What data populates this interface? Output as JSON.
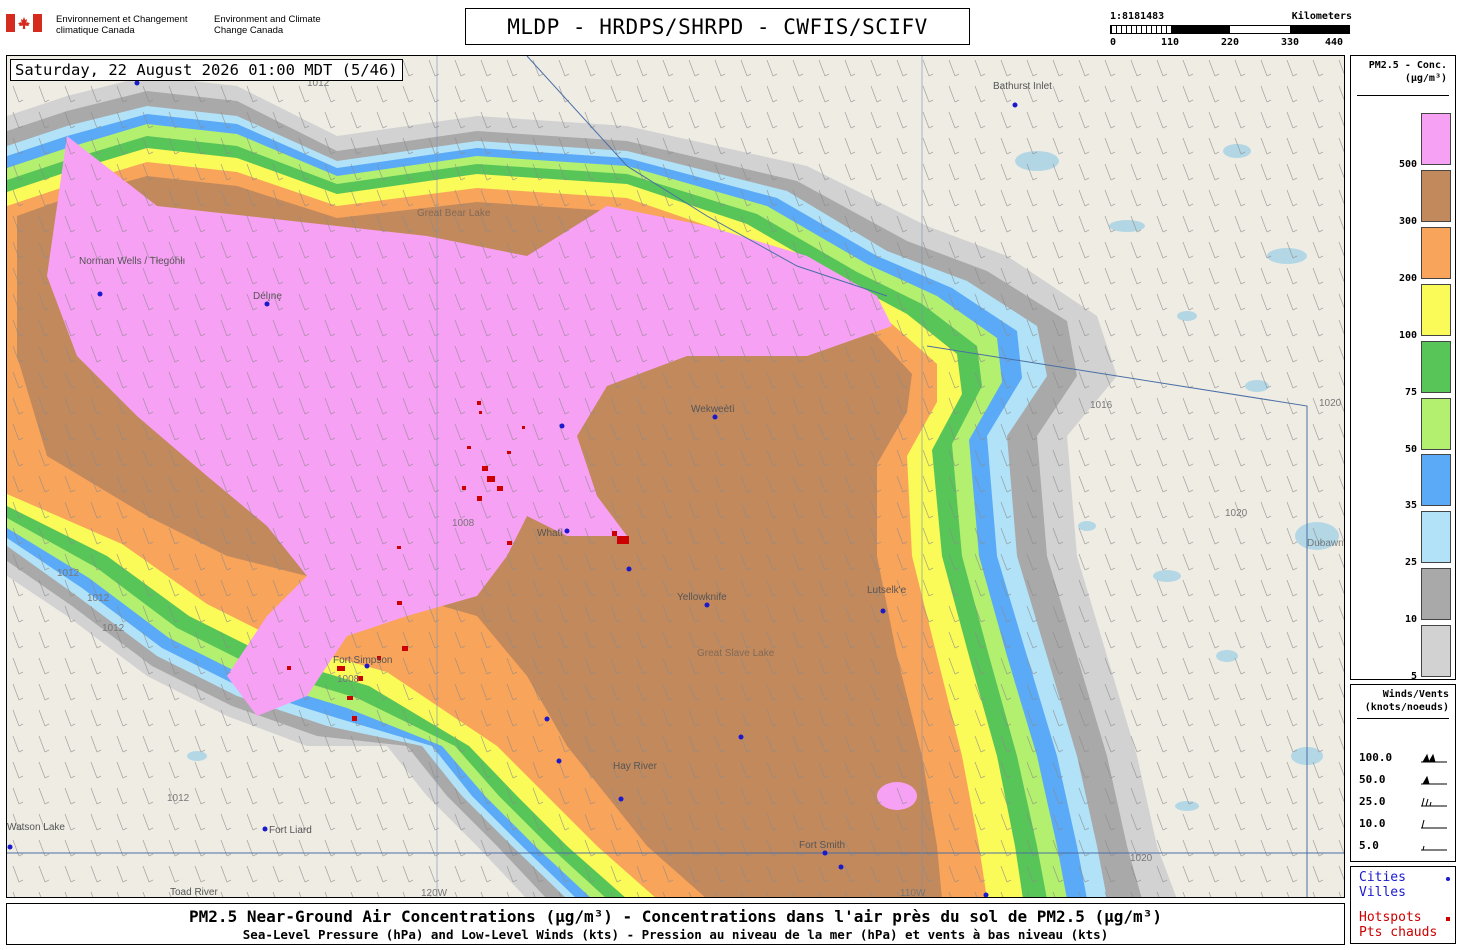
{
  "header": {
    "agency_fr": "Environnement et Changement climatique Canada",
    "agency_en": "Environment and Climate Change Canada",
    "title": "MLDP - HRDPS/SHRPD - CWFIS/SCIFV"
  },
  "scale": {
    "ratio": "1:8181483",
    "unit": "Kilometers",
    "ticks": [
      "0",
      "110",
      "220",
      "330",
      "440"
    ]
  },
  "map": {
    "timestamp": "Saturday, 22 August 2026 01:00 MDT (5/46)",
    "places": [
      {
        "name": "Bathurst Inlet"
      },
      {
        "name": "Norman Wells / Tłegóhłı"
      },
      {
        "name": "Délı̨nę"
      },
      {
        "name": "Great Bear Lake"
      },
      {
        "name": "Wekweètì"
      },
      {
        "name": "Whatì"
      },
      {
        "name": "Yellowknife"
      },
      {
        "name": "Fort Simpson"
      },
      {
        "name": "Lutselk'e"
      },
      {
        "name": "Hay River"
      },
      {
        "name": "Fort Liard"
      },
      {
        "name": "Fort Smith"
      },
      {
        "name": "Toad River"
      },
      {
        "name": "Dubawnt Lake"
      },
      {
        "name": "Watson Lake"
      },
      {
        "name": "Great Slave Lake"
      }
    ],
    "isobars": [
      "1008",
      "1012",
      "1016",
      "1020"
    ],
    "meridians": [
      "120W",
      "110W"
    ]
  },
  "legend": {
    "title": "PM2.5 - Conc. (µg/m³)",
    "bins": [
      {
        "label": "500",
        "color": "#f7a1f4"
      },
      {
        "label": "300",
        "color": "#c2895c"
      },
      {
        "label": "200",
        "color": "#f9a45b"
      },
      {
        "label": "100",
        "color": "#fafa59"
      },
      {
        "label": "75",
        "color": "#58c558"
      },
      {
        "label": "50",
        "color": "#b3f06f"
      },
      {
        "label": "35",
        "color": "#5aaaf7"
      },
      {
        "label": "25",
        "color": "#b2e2f8"
      },
      {
        "label": "10",
        "color": "#a9a9a9"
      },
      {
        "label": "5",
        "color": "#d2d2d2"
      }
    ]
  },
  "winds": {
    "title": "Winds/Vents (knots/noeuds)",
    "rows": [
      "100.0",
      "50.0",
      "25.0",
      "10.0",
      "5.0"
    ]
  },
  "cities_legend": {
    "cities_en": "Cities",
    "cities_fr": "Villes",
    "city_color": "#1a1acc",
    "hotspots_en": "Hotspots",
    "hotspots_fr": "Pts chauds",
    "hotspot_color": "#cc0000"
  },
  "footer": {
    "line1": "PM2.5 Near-Ground Air Concentrations (µg/m³) - Concentrations dans l'air près du sol de PM2.5 (µg/m³)",
    "line2": "Sea-Level Pressure (hPa) and Low-Level Winds (kts) - Pression au niveau de la mer (hPa) et vents à bas niveau (kts)"
  }
}
